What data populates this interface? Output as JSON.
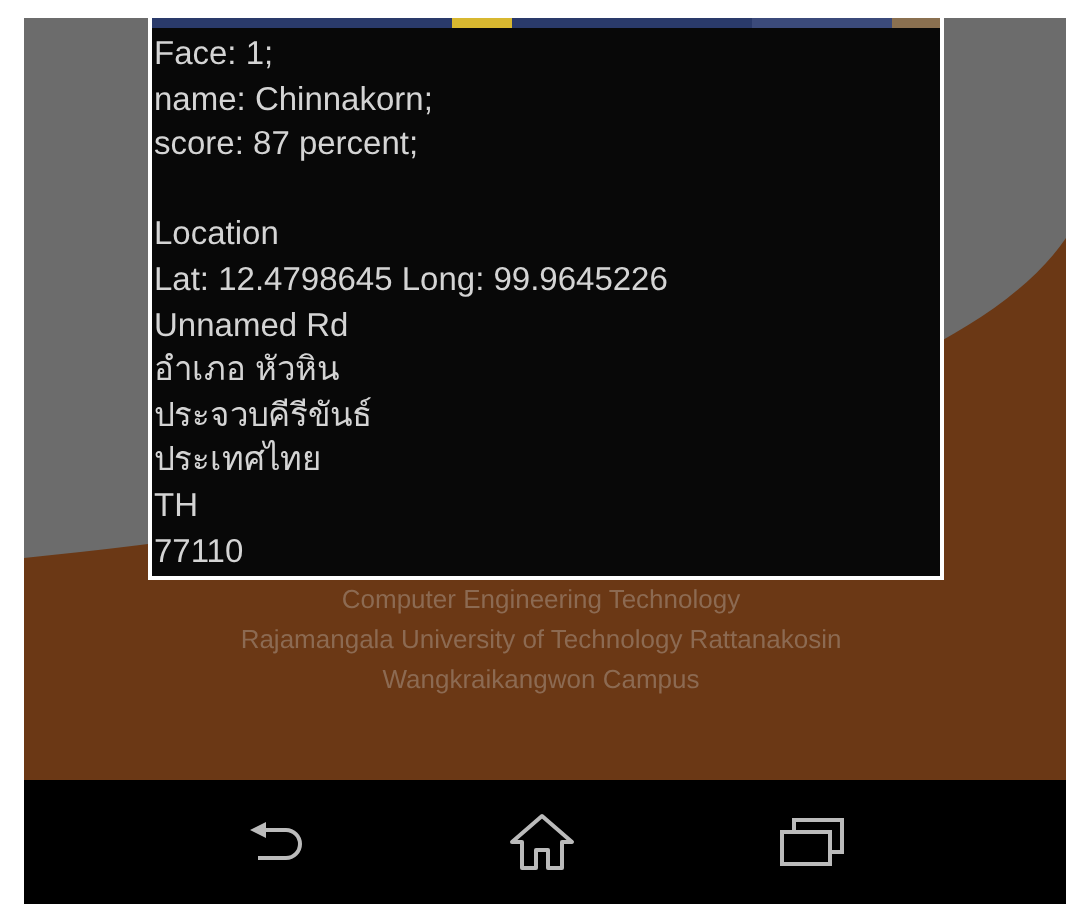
{
  "dialog": {
    "blocks": [
      [
        "Face: 1;",
        "name: Chinnakorn;",
        "score: 87 percent;"
      ],
      [
        "Location",
        "Lat: 12.4798645 Long: 99.9645226",
        "Unnamed Rd",
        "อำเภอ หัวหิน",
        "ประจวบคีรีขันธ์",
        "ประเทศไทย",
        "TH",
        "77110"
      ]
    ]
  },
  "footer": [
    "Computer Engineering Technology",
    "Rajamangala University of Technology Rattanakosin",
    "Wangkraikangwon Campus"
  ],
  "nav_bar": [
    {
      "kind": "back"
    },
    {
      "kind": "home"
    },
    {
      "kind": "recents"
    }
  ]
}
